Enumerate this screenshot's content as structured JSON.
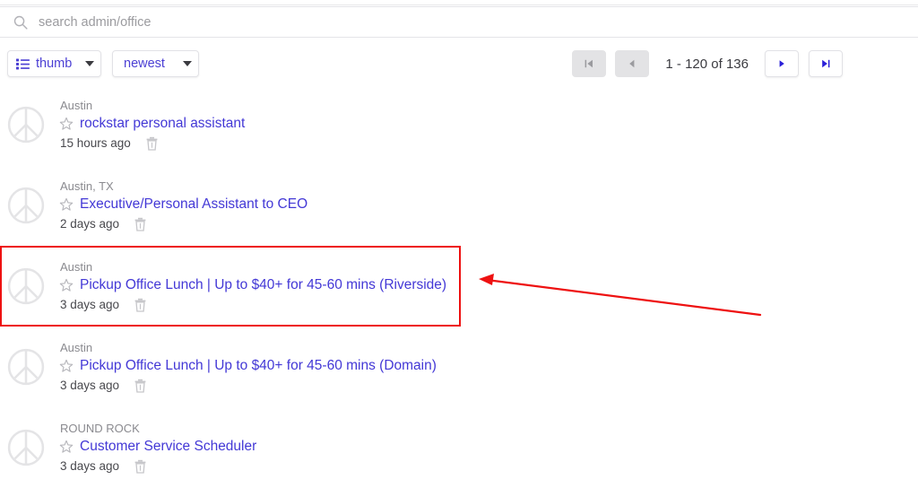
{
  "search": {
    "placeholder": "search admin/office",
    "value": "",
    "icon": "search-icon"
  },
  "toolbar": {
    "view_mode": {
      "label": "thumb",
      "icon": "list-view-icon",
      "caret": "chevron-down-icon"
    },
    "sort_mode": {
      "label": "newest",
      "caret": "chevron-down-icon"
    }
  },
  "pagination": {
    "range_text": "1 - 120 of 136",
    "start": 1,
    "end": 120,
    "total": 136,
    "buttons": [
      {
        "name": "first-page-button",
        "icon": "first-page-icon",
        "state": "disabled"
      },
      {
        "name": "prev-page-button",
        "icon": "previous-page-icon",
        "state": "disabled"
      },
      {
        "name": "next-page-button",
        "icon": "next-page-icon",
        "state": "enabled"
      },
      {
        "name": "last-page-button",
        "icon": "last-page-icon",
        "state": "enabled"
      }
    ]
  },
  "listings": [
    {
      "location": "Austin",
      "title": "rockstar personal assistant",
      "age": "15 hours ago",
      "thumbnail_icon": "peace-sign-placeholder-icon",
      "star_icon": "star-outline-icon",
      "delete_icon": "trash-icon",
      "highlighted": false
    },
    {
      "location": "Austin, TX",
      "title": "Executive/Personal Assistant to CEO",
      "age": "2 days ago",
      "thumbnail_icon": "peace-sign-placeholder-icon",
      "star_icon": "star-outline-icon",
      "delete_icon": "trash-icon",
      "highlighted": false
    },
    {
      "location": "Austin",
      "title": "Pickup Office Lunch | Up to $40+ for 45-60 mins (Riverside)",
      "age": "3 days ago",
      "thumbnail_icon": "peace-sign-placeholder-icon",
      "star_icon": "star-outline-icon",
      "delete_icon": "trash-icon",
      "highlighted": true
    },
    {
      "location": "Austin",
      "title": "Pickup Office Lunch | Up to $40+ for 45-60 mins (Domain)",
      "age": "3 days ago",
      "thumbnail_icon": "peace-sign-placeholder-icon",
      "star_icon": "star-outline-icon",
      "delete_icon": "trash-icon",
      "highlighted": false
    },
    {
      "location": "ROUND ROCK",
      "title": "Customer Service Scheduler",
      "age": "3 days ago",
      "thumbnail_icon": "peace-sign-placeholder-icon",
      "star_icon": "star-outline-icon",
      "delete_icon": "trash-icon",
      "highlighted": false
    }
  ],
  "annotation": {
    "highlight_box_color": "#ee1111",
    "arrow_color": "#ee1111",
    "arrow_points_to": "Pickup Office Lunch | Up to $40+ for 45-60 mins (Riverside)"
  },
  "colors": {
    "link": "#4338d6",
    "accent": "#4b3fd4",
    "muted_text": "#8a8a8f",
    "body_text": "#48484d",
    "placeholder_icon": "#e2e2e4",
    "border": "#e2e2e6",
    "disabled_button": "#e3e3e5",
    "annotation": "#ee1111"
  }
}
